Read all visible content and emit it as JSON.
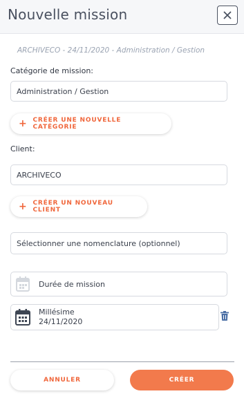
{
  "header": {
    "title": "Nouvelle mission",
    "close_icon": "close-icon"
  },
  "subtitle": "ARCHIVECO - 24/11/2020 - Administration / Gestion",
  "category": {
    "label": "Catégorie de mission:",
    "value": "Administration / Gestion",
    "create_button": "CRÉER UNE NOUVELLE CATÉGORIE"
  },
  "client": {
    "label": "Client:",
    "value": "ARCHIVECO",
    "create_button": "CRÉER UN NOUVEAU CLIENT"
  },
  "nomenclature": {
    "placeholder": "Sélectionner une nomenclature (optionnel)"
  },
  "duration": {
    "placeholder": "Durée de mission",
    "icon": "calendar-icon"
  },
  "millesime": {
    "label": "Millésime",
    "value": "24/11/2020",
    "icon": "calendar-icon",
    "delete_icon": "trash-icon"
  },
  "footer": {
    "cancel": "ANNULER",
    "create": "CRÉER"
  },
  "colors": {
    "accent": "#f0673c",
    "primary_button": "#f27a4c",
    "trash": "#4a6fa5"
  }
}
